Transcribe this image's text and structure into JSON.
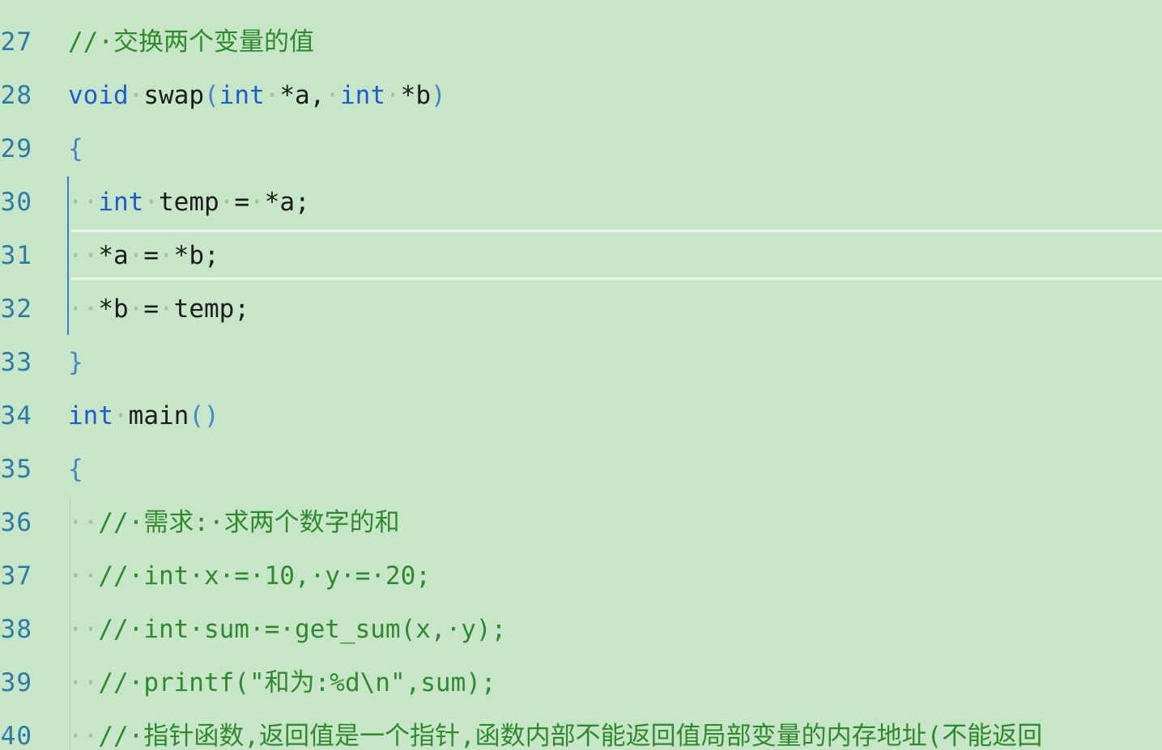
{
  "editor": {
    "lines": [
      {
        "number": "27",
        "tokens": [
          {
            "t": "cm",
            "v": "//·交换两个变量的值"
          }
        ]
      },
      {
        "number": "28",
        "tokens": [
          {
            "t": "kw",
            "v": "void"
          },
          {
            "t": "ws",
            "v": "·"
          },
          {
            "t": "",
            "v": "swap"
          },
          {
            "t": "br",
            "v": "("
          },
          {
            "t": "kw",
            "v": "int"
          },
          {
            "t": "ws",
            "v": "·"
          },
          {
            "t": "",
            "v": "*a,"
          },
          {
            "t": "ws",
            "v": "·"
          },
          {
            "t": "kw",
            "v": "int"
          },
          {
            "t": "ws",
            "v": "·"
          },
          {
            "t": "",
            "v": "*b"
          },
          {
            "t": "br",
            "v": ")"
          }
        ]
      },
      {
        "number": "29",
        "tokens": [
          {
            "t": "br",
            "v": "{"
          }
        ]
      },
      {
        "number": "30",
        "tokens": [
          {
            "t": "ws",
            "v": "··"
          },
          {
            "t": "kw",
            "v": "int"
          },
          {
            "t": "ws",
            "v": "·"
          },
          {
            "t": "",
            "v": "temp"
          },
          {
            "t": "ws",
            "v": "·"
          },
          {
            "t": "",
            "v": "="
          },
          {
            "t": "ws",
            "v": "·"
          },
          {
            "t": "",
            "v": "*a;"
          }
        ]
      },
      {
        "number": "31",
        "tokens": [
          {
            "t": "ws",
            "v": "··"
          },
          {
            "t": "",
            "v": "*a"
          },
          {
            "t": "ws",
            "v": "·"
          },
          {
            "t": "",
            "v": "="
          },
          {
            "t": "ws",
            "v": "·"
          },
          {
            "t": "",
            "v": "*b;"
          }
        ]
      },
      {
        "number": "32",
        "tokens": [
          {
            "t": "ws",
            "v": "··"
          },
          {
            "t": "",
            "v": "*b"
          },
          {
            "t": "ws",
            "v": "·"
          },
          {
            "t": "",
            "v": "="
          },
          {
            "t": "ws",
            "v": "·"
          },
          {
            "t": "",
            "v": "temp;"
          }
        ]
      },
      {
        "number": "33",
        "tokens": [
          {
            "t": "br",
            "v": "}"
          }
        ]
      },
      {
        "number": "34",
        "tokens": [
          {
            "t": "kw",
            "v": "int"
          },
          {
            "t": "ws",
            "v": "·"
          },
          {
            "t": "",
            "v": "main"
          },
          {
            "t": "br",
            "v": "()"
          }
        ]
      },
      {
        "number": "35",
        "tokens": [
          {
            "t": "br",
            "v": "{"
          }
        ]
      },
      {
        "number": "36",
        "tokens": [
          {
            "t": "ws",
            "v": "··"
          },
          {
            "t": "cm",
            "v": "//·需求:·求两个数字的和"
          }
        ]
      },
      {
        "number": "37",
        "tokens": [
          {
            "t": "ws",
            "v": "··"
          },
          {
            "t": "cm",
            "v": "//·int·x·=·10,·y·=·20;"
          }
        ]
      },
      {
        "number": "38",
        "tokens": [
          {
            "t": "ws",
            "v": "··"
          },
          {
            "t": "cm",
            "v": "//·int·sum·=·get_sum(x,·y);"
          }
        ]
      },
      {
        "number": "39",
        "tokens": [
          {
            "t": "ws",
            "v": "··"
          },
          {
            "t": "cm",
            "v": "//·printf(\"和为:%d\\n\",sum);"
          }
        ]
      },
      {
        "number": "40",
        "tokens": [
          {
            "t": "ws",
            "v": "··"
          },
          {
            "t": "cm",
            "v": "//·指针函数,返回值是一个指针,函数内部不能返回值局部变量的内存地址(不能返回"
          }
        ]
      }
    ]
  },
  "colors": {
    "background": "#c7e6c8",
    "keyword": "#1f5bd0",
    "comment": "#2e8a2c",
    "line_number": "#2b7aa7",
    "bracket": "#4a82c7",
    "scope_guide": "#3a7fcf"
  }
}
